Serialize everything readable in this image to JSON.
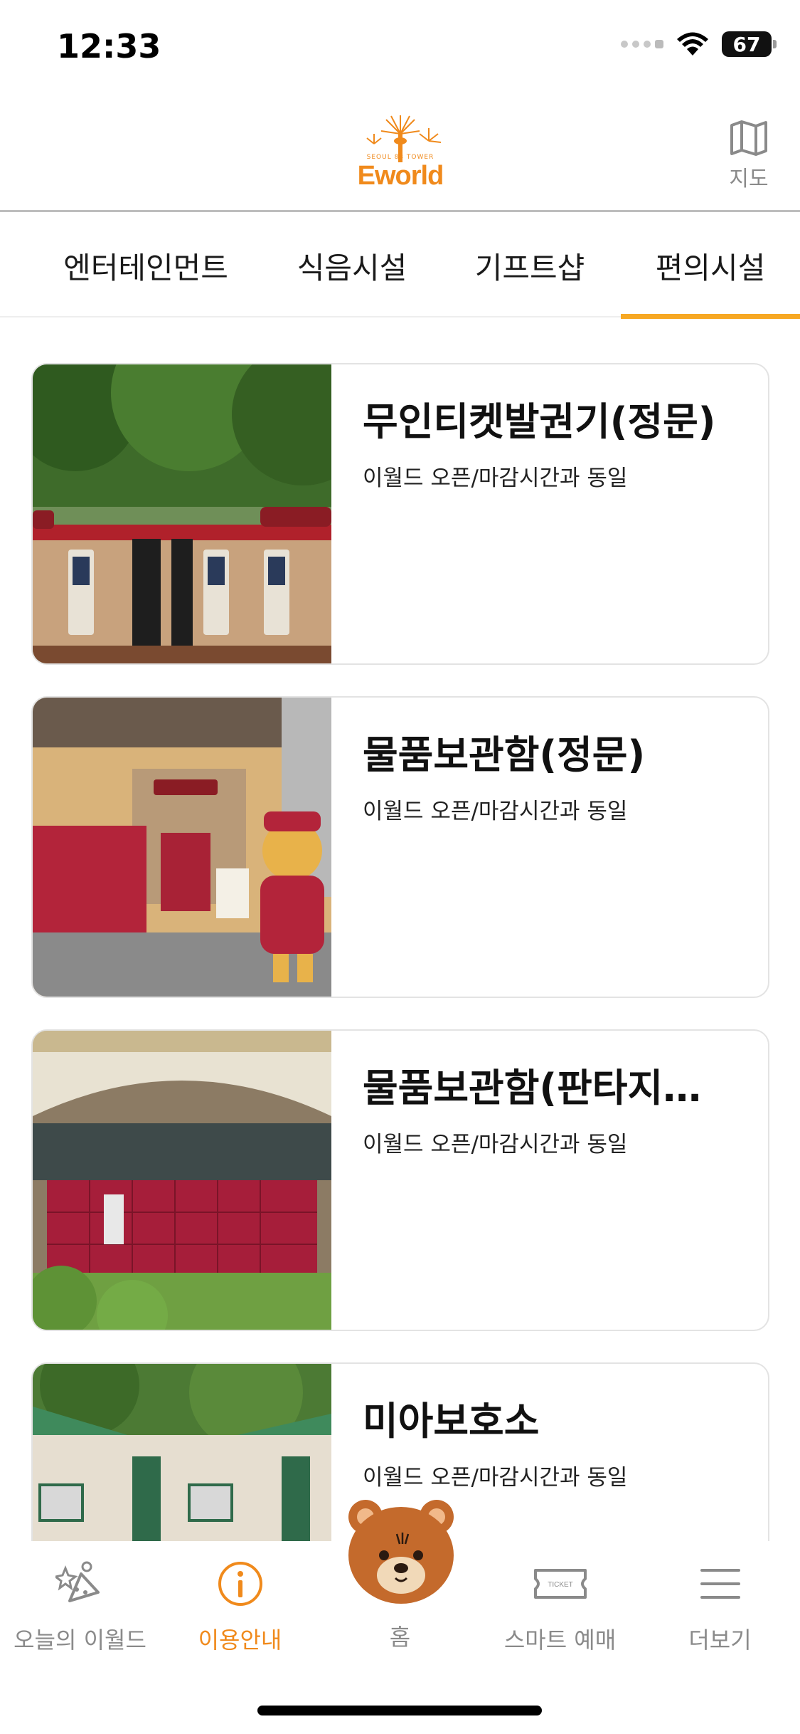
{
  "status": {
    "time": "12:33",
    "battery": "67"
  },
  "header": {
    "logo_text": "Eworld",
    "logo_subtext": "SEOUL 83 TOWER",
    "map_label": "지도"
  },
  "tabs": [
    {
      "label": "엔터테인먼트",
      "active": false
    },
    {
      "label": "식음시설",
      "active": false
    },
    {
      "label": "기프트샵",
      "active": false
    },
    {
      "label": "편의시설",
      "active": true
    }
  ],
  "facilities": [
    {
      "title": "무인티켓발권기(정문)",
      "desc": "이월드 오픈/마감시간과 동일",
      "image": "self-ticketing-kiosks-photo"
    },
    {
      "title": "물품보관함(정문)",
      "desc": "이월드 오픈/마감시간과 동일",
      "image": "lockers-with-bear-mascot-photo"
    },
    {
      "title": "물품보관함(판타지…",
      "desc": "이월드 오픈/마감시간과 동일",
      "image": "red-lockers-photo"
    },
    {
      "title": "미아보호소",
      "desc": "이월드 오픈/마감시간과 동일",
      "image": "first-aid-safety-office-photo"
    }
  ],
  "nav": {
    "today": "오늘의 이월드",
    "info": "이용안내",
    "home": "홈",
    "ticket": "스마트 예매",
    "more": "더보기",
    "ticket_icon_text": "TICKET"
  },
  "colors": {
    "accent": "#f7a823",
    "active_text": "#f08a1c",
    "muted": "#8a8a8a"
  }
}
